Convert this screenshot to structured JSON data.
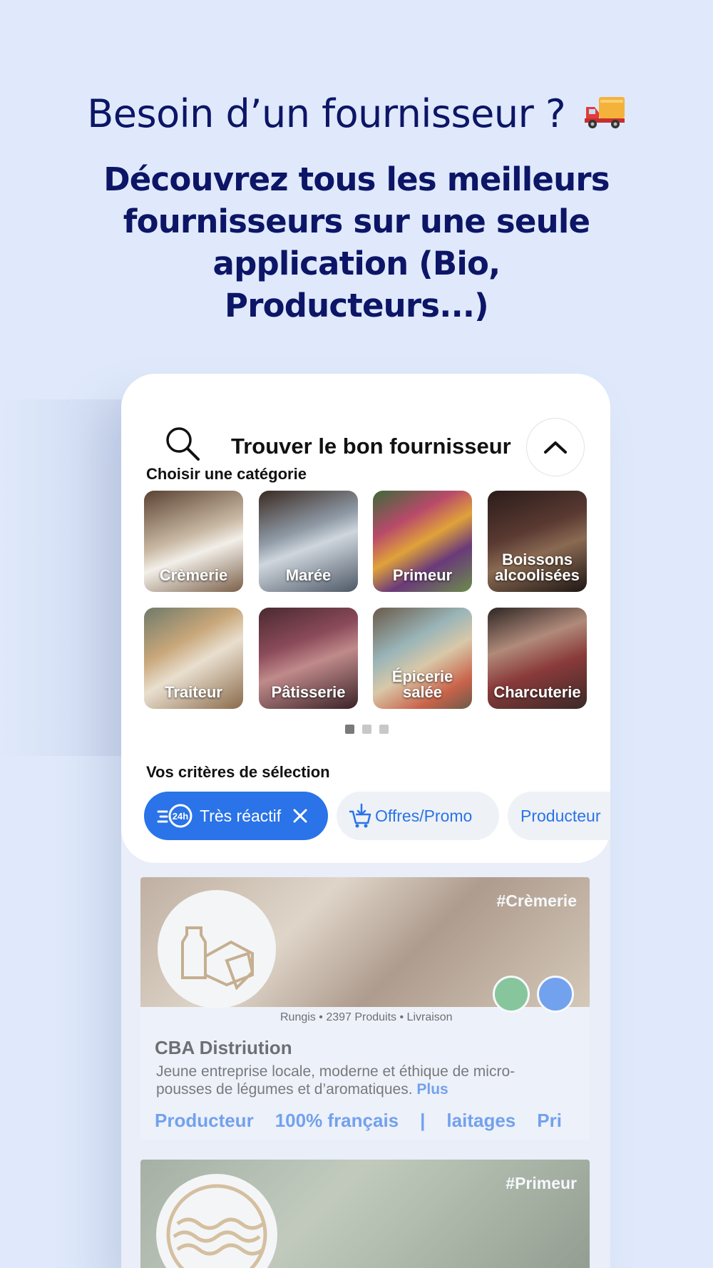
{
  "hero": {
    "headline": "Besoin d’un fournisseur ?",
    "subheadline": "Découvrez tous les meilleurs fournisseurs sur une seule application (Bio, Producteurs...)"
  },
  "search": {
    "title": "Trouver le bon fournisseur",
    "icon": "search-icon",
    "collapse_icon": "chevron-up-icon"
  },
  "categories": {
    "label": "Choisir une catégorie",
    "items": [
      {
        "label": "Crèmerie",
        "color": "#8a6b52"
      },
      {
        "label": "Marée",
        "color": "#5a6472"
      },
      {
        "label": "Primeur",
        "color": "#7a4a3a"
      },
      {
        "label": "Boissons alcoolisées",
        "color": "#3b2b28"
      },
      {
        "label": "Traiteur",
        "color": "#8d7a62"
      },
      {
        "label": "Pâtisserie",
        "color": "#5a3940"
      },
      {
        "label": "Épicerie salée",
        "color": "#6f7c6f"
      },
      {
        "label": "Charcuterie",
        "color": "#5a3c36"
      }
    ],
    "pager": {
      "pages": 3,
      "active": 1
    }
  },
  "criteria": {
    "label": "Vos critères de sélection",
    "chips": [
      {
        "label": "Très réactif",
        "active": true,
        "icon": "fast-24h-icon"
      },
      {
        "label": "Offres/Promo",
        "active": false,
        "icon": "cart-promo-icon"
      },
      {
        "label": "Producteur",
        "active": false
      }
    ]
  },
  "suppliers": [
    {
      "tag": "#Crèmerie",
      "name": "CBA Distriution",
      "location": "Rungis",
      "products": "2397 Produits",
      "delivery": "Livraison",
      "description": "Jeune entreprise locale, moderne et éthique de micro-pousses de légumes et d’aromatiques.",
      "more": "Plus",
      "tags": [
        "Producteur",
        "100% français",
        "|",
        "laitages",
        "Pri"
      ],
      "logo_icon": "cheese-logo-icon"
    },
    {
      "tag": "#Primeur",
      "logo_icon": "wave-logo-icon"
    }
  ],
  "colors": {
    "background": "#dfe9fb",
    "navy": "#0c1566",
    "accent": "#2a73e8"
  }
}
